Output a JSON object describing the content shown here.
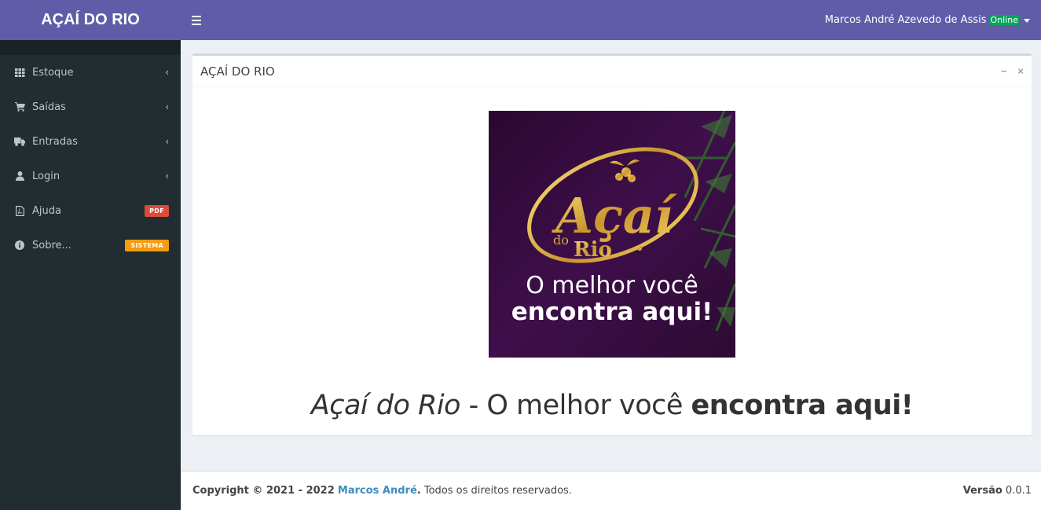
{
  "brand": {
    "title": "AÇAÍ DO RIO"
  },
  "topbar": {
    "user_name": "Marcos André Azevedo de Assis",
    "status": "Online"
  },
  "sidebar": {
    "items": [
      {
        "label": "Estoque",
        "icon": "th-icon"
      },
      {
        "label": "Saídas",
        "icon": "cart-icon"
      },
      {
        "label": "Entradas",
        "icon": "truck-icon"
      },
      {
        "label": "Login",
        "icon": "user-icon"
      },
      {
        "label": "Ajuda",
        "icon": "file-pdf-icon",
        "badge": "PDF"
      },
      {
        "label": "Sobre...",
        "icon": "info-icon",
        "badge": "SISTEMA"
      }
    ]
  },
  "box": {
    "title": "AÇAÍ DO RIO",
    "logo": {
      "script": "Açaí",
      "sub1": "do",
      "sub2": "Rio",
      "line1": "O melhor você",
      "line2": "encontra aqui!"
    },
    "tagline": {
      "brand": "Açaí do Rio",
      "sep": " - O melhor você ",
      "strong": "encontra aqui!"
    }
  },
  "footer": {
    "copyright": "Copyright © 2021 - 2022",
    "author": "Marcos André",
    "rights": "Todos os direitos reservados.",
    "version_label": "Versão",
    "version": "0.0.1"
  },
  "colors": {
    "header": "#605ca8",
    "sidebar": "#222d32",
    "online": "#00a65a",
    "pdf_badge": "#dd4b39",
    "system_badge": "#f39c12"
  }
}
